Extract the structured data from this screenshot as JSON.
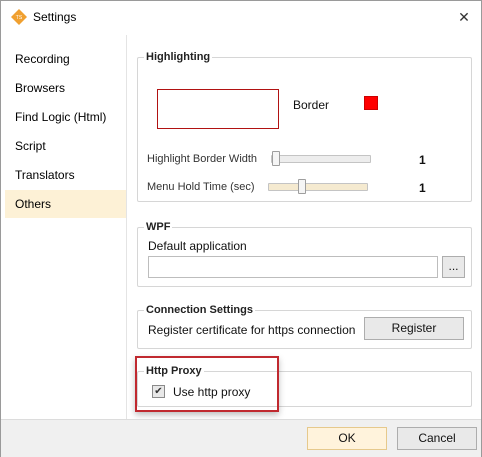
{
  "window": {
    "title": "Settings",
    "close_glyph": "✕"
  },
  "sidebar": {
    "items": [
      {
        "label": "Recording"
      },
      {
        "label": "Browsers"
      },
      {
        "label": "Find Logic (Html)"
      },
      {
        "label": "Script"
      },
      {
        "label": "Translators"
      },
      {
        "label": "Others",
        "selected": true
      }
    ]
  },
  "highlighting": {
    "title": "Highlighting",
    "border_label": "Border",
    "border_color": "#ff0000",
    "width_label": "Highlight Border Width",
    "width_value": "1",
    "hold_label": "Menu Hold Time (sec)",
    "hold_value": "1"
  },
  "wpf": {
    "title": "WPF",
    "default_app_label": "Default application",
    "default_app_value": "",
    "browse_label": "..."
  },
  "connection": {
    "title": "Connection Settings",
    "register_text": "Register certificate for https connection",
    "register_button": "Register"
  },
  "proxy": {
    "title": "Http Proxy",
    "use_proxy_label": "Use http proxy",
    "use_proxy_checked": true,
    "check_glyph": "✔"
  },
  "footer": {
    "ok_label": "OK",
    "cancel_label": "Cancel"
  },
  "colors": {
    "accent": "#f0a030",
    "selected_bg": "#fdf1d6",
    "highlight_frame": "#c0292f"
  }
}
